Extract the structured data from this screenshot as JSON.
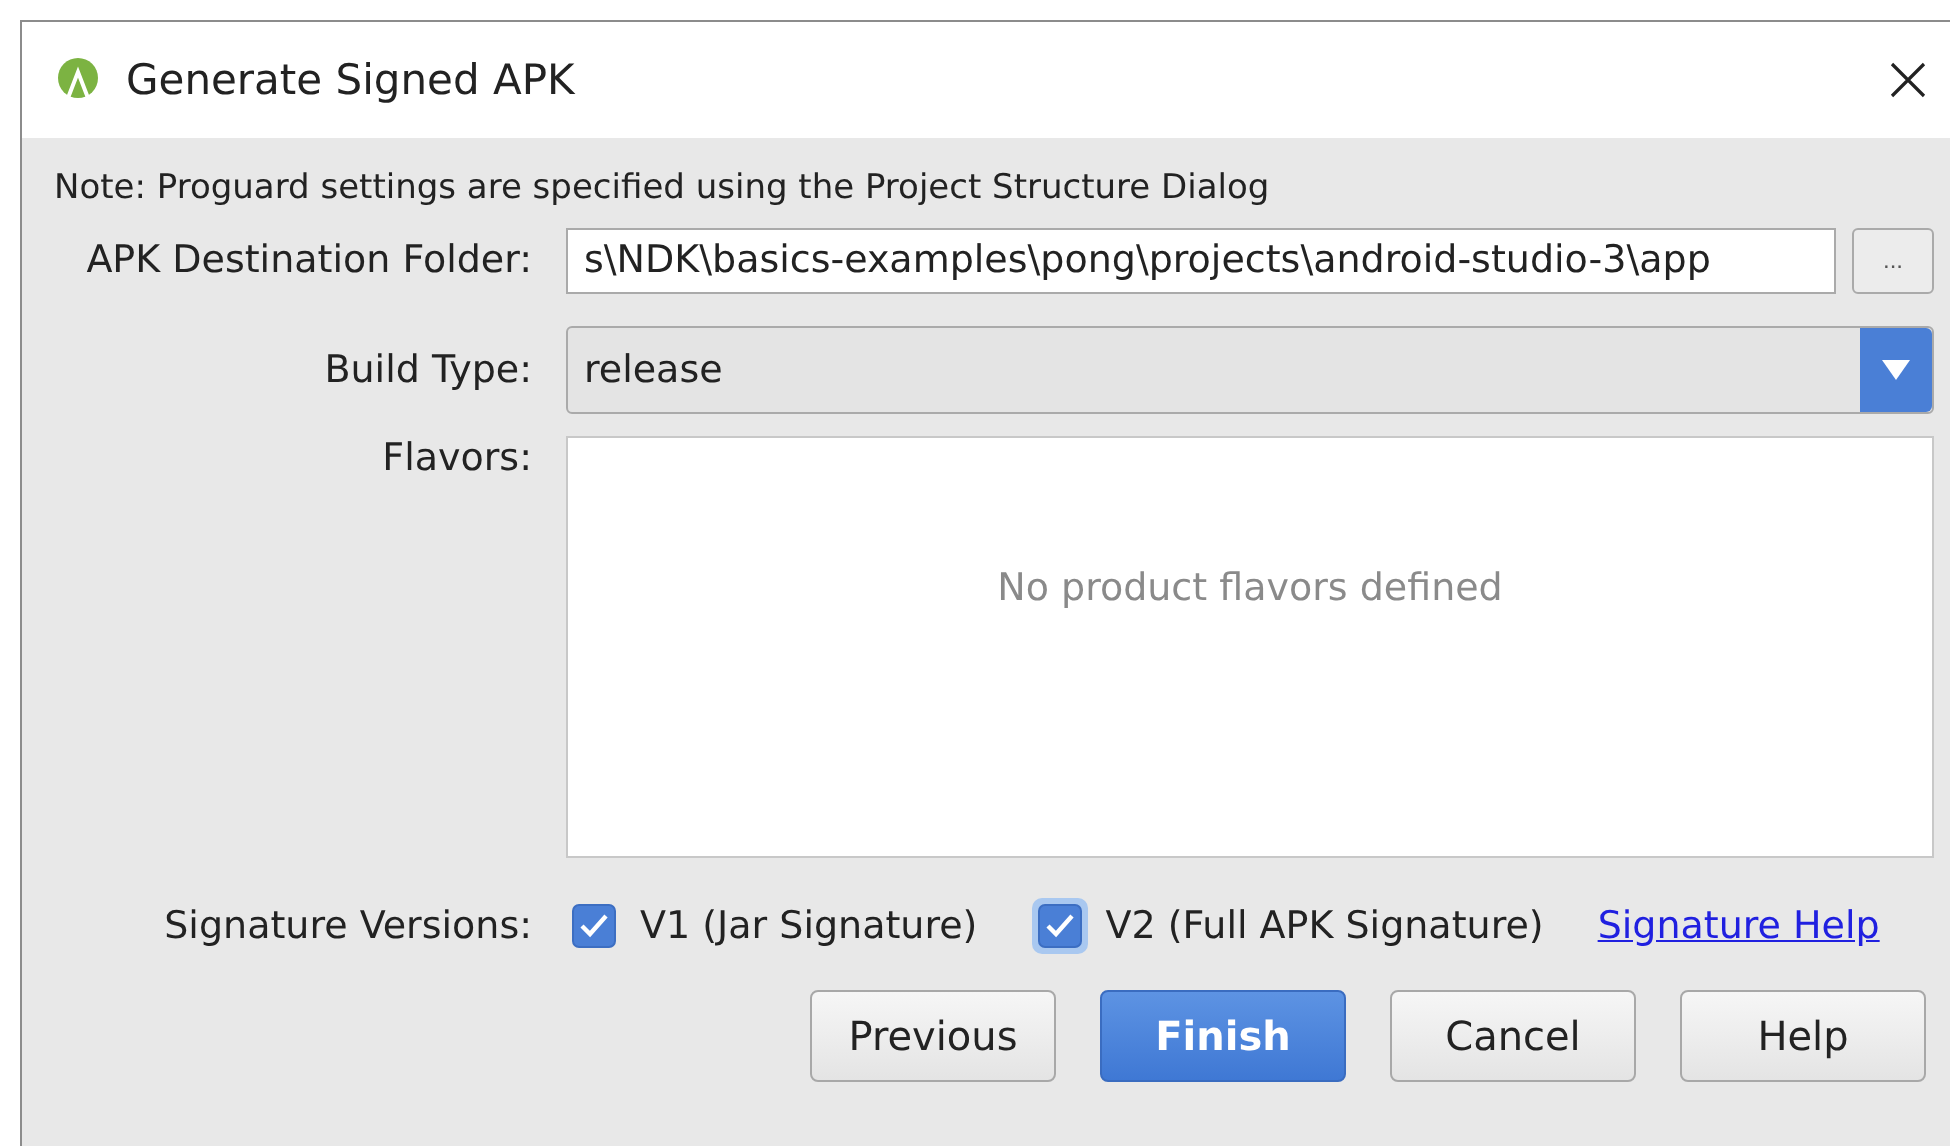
{
  "window": {
    "title": "Generate Signed APK"
  },
  "note": "Note: Proguard settings are specified using the Project Structure Dialog",
  "destination": {
    "label": "APK Destination Folder:",
    "value": "s\\NDK\\basics-examples\\pong\\projects\\android-studio-3\\app",
    "browse": "..."
  },
  "build_type": {
    "label": "Build Type:",
    "value": "release"
  },
  "flavors": {
    "label": "Flavors:",
    "empty_text": "No product flavors defined"
  },
  "signature": {
    "label": "Signature Versions:",
    "options": [
      {
        "label": "V1 (Jar Signature)",
        "checked": true,
        "focused": false
      },
      {
        "label": "V2 (Full APK Signature)",
        "checked": true,
        "focused": true
      }
    ],
    "help_link": "Signature Help"
  },
  "buttons": [
    {
      "label": "Previous",
      "default": false
    },
    {
      "label": "Finish",
      "default": true
    },
    {
      "label": "Cancel",
      "default": false
    },
    {
      "label": "Help",
      "default": false
    }
  ]
}
